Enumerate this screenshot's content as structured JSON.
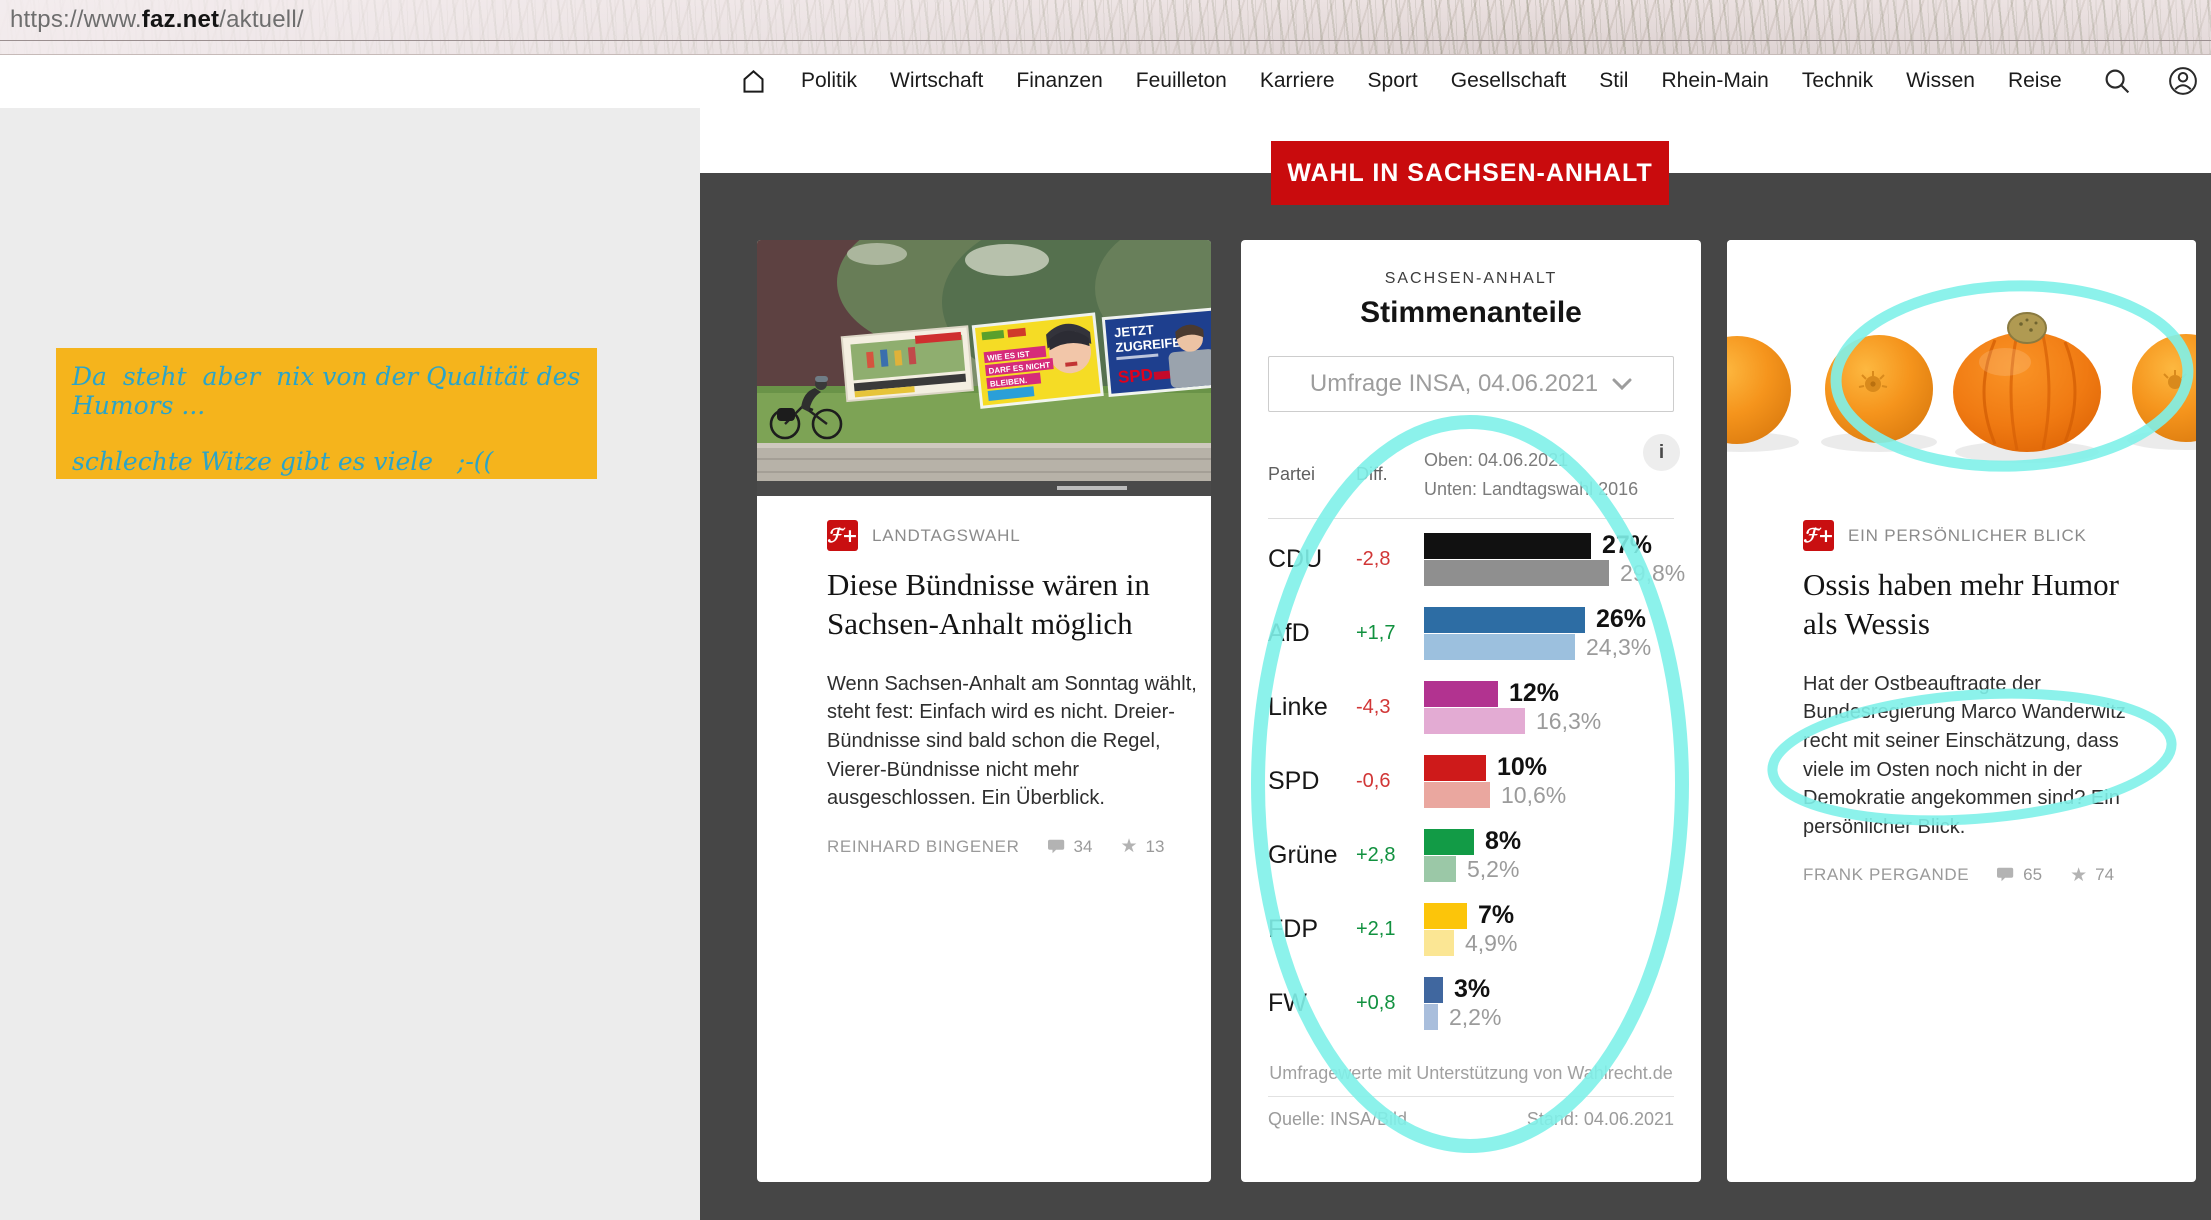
{
  "browser": {
    "url_prefix": "https://www.",
    "url_domain": "faz.net",
    "url_path": "/aktuell/"
  },
  "nav": {
    "items": [
      "Politik",
      "Wirtschaft",
      "Finanzen",
      "Feuilleton",
      "Karriere",
      "Sport",
      "Gesellschaft",
      "Stil",
      "Rhein-Main",
      "Technik",
      "Wissen",
      "Reise"
    ]
  },
  "banner": {
    "label": "WAHL IN SACHSEN-ANHALT",
    "color": "#c90b0d"
  },
  "note": {
    "line1": "Da  steht  aber  nix von der Qualität des Humors ...",
    "line2": "schlechte Witze gibt es viele   ;-((",
    "bg": "#f5b41c",
    "text_color": "#2ba4c8"
  },
  "articles": {
    "left": {
      "badge": "ℱ+",
      "kicker": "LANDTAGSWAHL",
      "title": "Diese Bündnisse wären in Sachsen-Anhalt möglich",
      "teaser": "Wenn Sachsen-Anhalt am Sonntag wählt, steht fest: Einfach wird es nicht. Dreier-Bündnisse sind bald schon die Regel, Vierer-Bündnisse nicht mehr ausgeschlossen. Ein Überblick.",
      "author": "REINHARD BINGENER",
      "comments": "34",
      "stars": "13",
      "image_texts": {
        "poster2_line1": "WIE ES IST",
        "poster2_line2": "DARF ES NICHT",
        "poster2_line3": "BLEIBEN.",
        "poster3_line1": "JETZT",
        "poster3_line2": "ZUGREIFEN.",
        "poster3_brand": "SPD"
      }
    },
    "right": {
      "badge": "ℱ+",
      "kicker": "EIN PERSÖNLICHER BLICK",
      "title": "Ossis haben mehr Humor als Wessis",
      "teaser": "Hat der Ostbeauftragte der Bundesregierung Marco Wanderwitz recht mit seiner Einschätzung, dass viele im Osten noch nicht in der Demokratie angekommen sind? Ein persönlicher Blick.",
      "author": "FRANK PERGANDE",
      "comments": "65",
      "stars": "74"
    }
  },
  "chart_data": {
    "type": "bar",
    "region": "SACHSEN-ANHALT",
    "title": "Stimmenanteile",
    "selector": "Umfrage INSA, 04.06.2021",
    "columns": {
      "party": "Partei",
      "diff": "Diff."
    },
    "legend": {
      "top": "Oben: 04.06.2021",
      "bottom": "Unten: Landtagswahl 2016"
    },
    "info_icon": "i",
    "xmax": 30,
    "diff_colors": {
      "pos": "#11913f",
      "neg": "#d13636"
    },
    "rows": [
      {
        "party": "CDU",
        "diff": "-2,8",
        "trend": "neg",
        "current": 27,
        "current_label": "27%",
        "previous": 29.8,
        "previous_label": "29,8%",
        "color_current": "#111111",
        "color_previous": "#8f8f8f"
      },
      {
        "party": "AfD",
        "diff": "+1,7",
        "trend": "pos",
        "current": 26,
        "current_label": "26%",
        "previous": 24.3,
        "previous_label": "24,3%",
        "color_current": "#2d6da4",
        "color_previous": "#9cc0de"
      },
      {
        "party": "Linke",
        "diff": "-4,3",
        "trend": "neg",
        "current": 12,
        "current_label": "12%",
        "previous": 16.3,
        "previous_label": "16,3%",
        "color_current": "#b23390",
        "color_previous": "#e3abd3"
      },
      {
        "party": "SPD",
        "diff": "-0,6",
        "trend": "neg",
        "current": 10,
        "current_label": "10%",
        "previous": 10.6,
        "previous_label": "10,6%",
        "color_current": "#ce1a1a",
        "color_previous": "#eaa79f"
      },
      {
        "party": "Grüne",
        "diff": "+2,8",
        "trend": "pos",
        "current": 8,
        "current_label": "8%",
        "previous": 5.2,
        "previous_label": "5,2%",
        "color_current": "#129b46",
        "color_previous": "#9bc8a7"
      },
      {
        "party": "FDP",
        "diff": "+2,1",
        "trend": "pos",
        "current": 7,
        "current_label": "7%",
        "previous": 4.9,
        "previous_label": "4,9%",
        "color_current": "#fcc50a",
        "color_previous": "#fbe694"
      },
      {
        "party": "FW",
        "diff": "+0,8",
        "trend": "pos",
        "current": 3,
        "current_label": "3%",
        "previous": 2.2,
        "previous_label": "2,2%",
        "color_current": "#40679f",
        "color_previous": "#a9bedc"
      }
    ],
    "footnote": "Umfragewerte mit Unterstützung von Wahlrecht.de",
    "source": "Quelle: INSA/Bild",
    "stand": "Stand: 04.06.2021"
  },
  "annotations": {
    "color": "#7ff1e9"
  }
}
